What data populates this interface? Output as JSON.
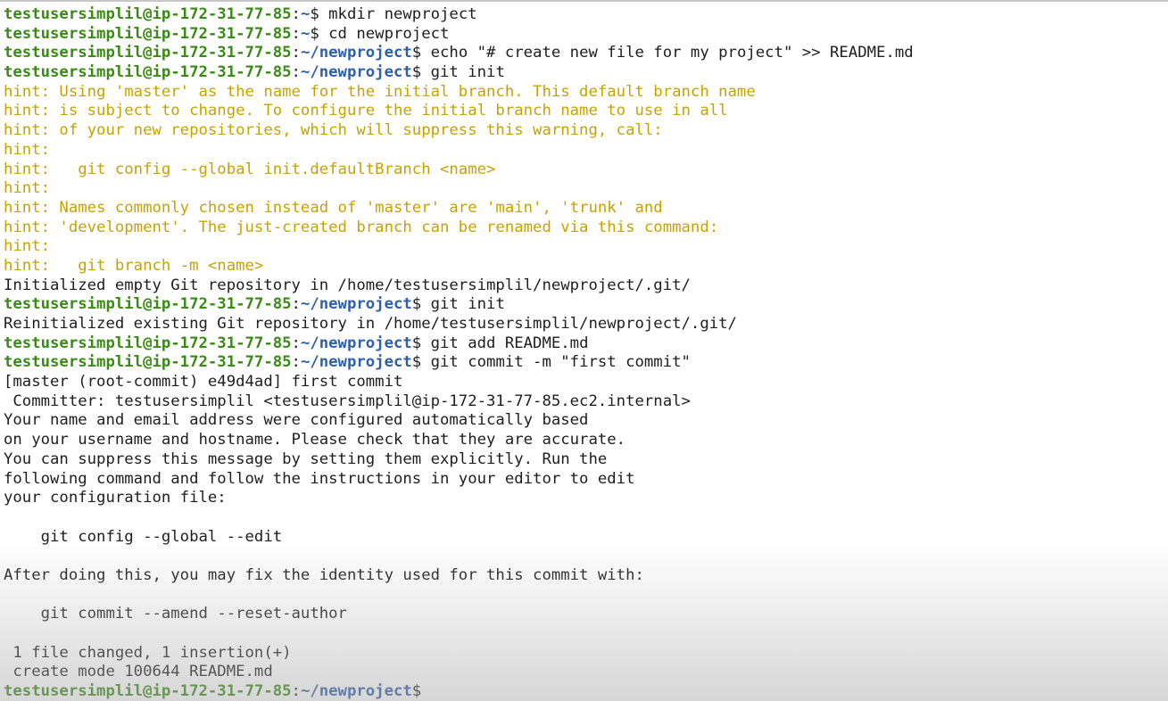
{
  "terminal": {
    "lines": [
      {
        "type": "prompt",
        "user": "testusersimplil@ip-172-31-77-85",
        "path": "~",
        "cmd": "mkdir newproject"
      },
      {
        "type": "prompt",
        "user": "testusersimplil@ip-172-31-77-85",
        "path": "~",
        "cmd": "cd newproject"
      },
      {
        "type": "prompt",
        "user": "testusersimplil@ip-172-31-77-85",
        "path": "~/newproject",
        "cmd": "echo \"# create new file for my project\" >> README.md"
      },
      {
        "type": "prompt",
        "user": "testusersimplil@ip-172-31-77-85",
        "path": "~/newproject",
        "cmd": "git init"
      },
      {
        "type": "hint",
        "text": "hint: Using 'master' as the name for the initial branch. This default branch name"
      },
      {
        "type": "hint",
        "text": "hint: is subject to change. To configure the initial branch name to use in all"
      },
      {
        "type": "hint",
        "text": "hint: of your new repositories, which will suppress this warning, call:"
      },
      {
        "type": "hint",
        "text": "hint:"
      },
      {
        "type": "hint",
        "text": "hint:   git config --global init.defaultBranch <name>"
      },
      {
        "type": "hint",
        "text": "hint:"
      },
      {
        "type": "hint",
        "text": "hint: Names commonly chosen instead of 'master' are 'main', 'trunk' and"
      },
      {
        "type": "hint",
        "text": "hint: 'development'. The just-created branch can be renamed via this command:"
      },
      {
        "type": "hint",
        "text": "hint:"
      },
      {
        "type": "hint",
        "text": "hint:   git branch -m <name>"
      },
      {
        "type": "output",
        "text": "Initialized empty Git repository in /home/testusersimplil/newproject/.git/"
      },
      {
        "type": "prompt",
        "user": "testusersimplil@ip-172-31-77-85",
        "path": "~/newproject",
        "cmd": "git init"
      },
      {
        "type": "output",
        "text": "Reinitialized existing Git repository in /home/testusersimplil/newproject/.git/"
      },
      {
        "type": "prompt",
        "user": "testusersimplil@ip-172-31-77-85",
        "path": "~/newproject",
        "cmd": "git add README.md"
      },
      {
        "type": "prompt",
        "user": "testusersimplil@ip-172-31-77-85",
        "path": "~/newproject",
        "cmd": "git commit -m \"first commit\""
      },
      {
        "type": "output",
        "text": "[master (root-commit) e49d4ad] first commit"
      },
      {
        "type": "output",
        "text": " Committer: testusersimplil <testusersimplil@ip-172-31-77-85.ec2.internal>"
      },
      {
        "type": "output",
        "text": "Your name and email address were configured automatically based"
      },
      {
        "type": "output",
        "text": "on your username and hostname. Please check that they are accurate."
      },
      {
        "type": "output",
        "text": "You can suppress this message by setting them explicitly. Run the"
      },
      {
        "type": "output",
        "text": "following command and follow the instructions in your editor to edit"
      },
      {
        "type": "output",
        "text": "your configuration file:"
      },
      {
        "type": "output",
        "text": ""
      },
      {
        "type": "output",
        "text": "    git config --global --edit"
      },
      {
        "type": "output",
        "text": ""
      },
      {
        "type": "output",
        "text": "After doing this, you may fix the identity used for this commit with:"
      },
      {
        "type": "output",
        "text": ""
      },
      {
        "type": "output",
        "text": "    git commit --amend --reset-author"
      },
      {
        "type": "output",
        "text": ""
      },
      {
        "type": "output",
        "text": " 1 file changed, 1 insertion(+)"
      },
      {
        "type": "output",
        "text": " create mode 100644 README.md"
      },
      {
        "type": "prompt",
        "user": "testusersimplil@ip-172-31-77-85",
        "path": "~/newproject",
        "cmd": ""
      }
    ]
  },
  "colors": {
    "background": "#ffffff",
    "prompt_user": "#3a8a16",
    "prompt_path": "#2e5fa8",
    "hint_text": "#c7a200",
    "output_text": "#1e1e1e"
  }
}
